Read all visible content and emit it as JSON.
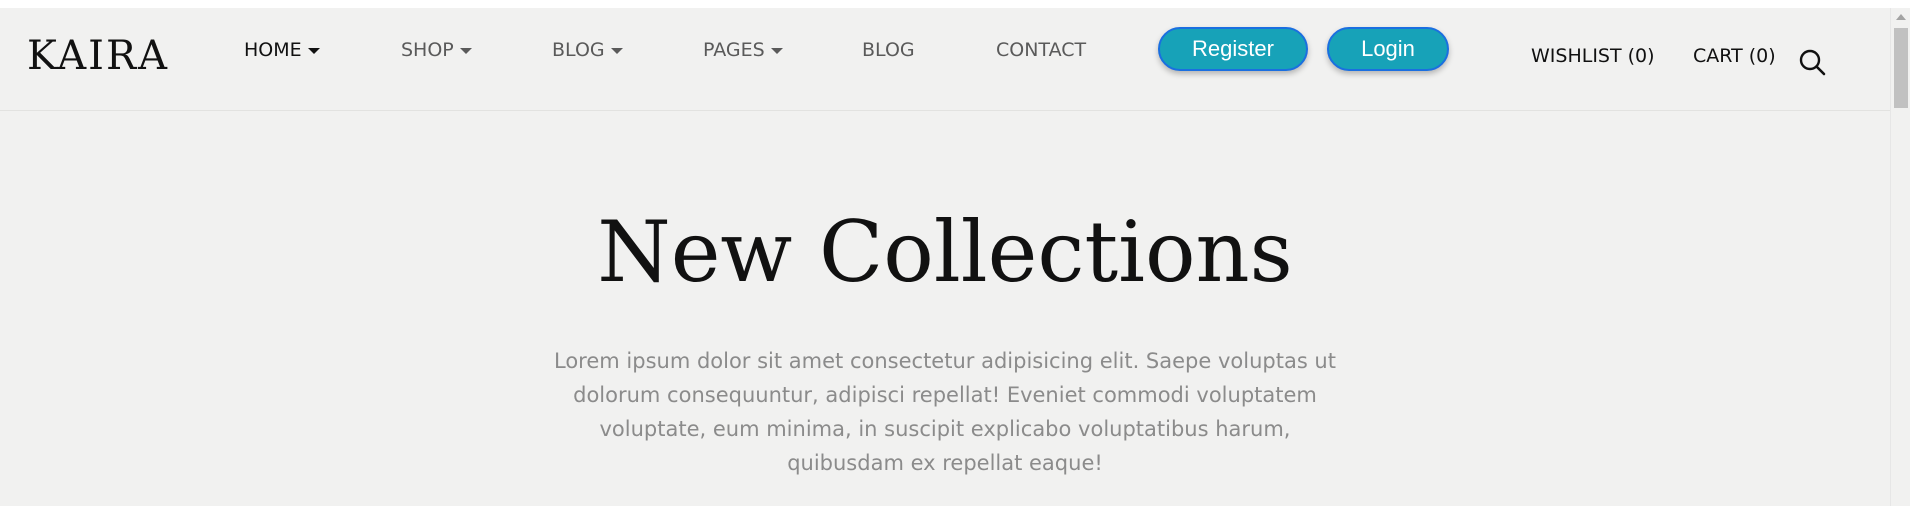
{
  "brand": {
    "logo": "KAIRA"
  },
  "nav": {
    "items": [
      {
        "label": "HOME",
        "dropdown": true,
        "active": true
      },
      {
        "label": "SHOP",
        "dropdown": true,
        "active": false
      },
      {
        "label": "BLOG",
        "dropdown": true,
        "active": false
      },
      {
        "label": "PAGES",
        "dropdown": true,
        "active": false
      },
      {
        "label": "BLOG",
        "dropdown": false,
        "active": false
      },
      {
        "label": "CONTACT",
        "dropdown": false,
        "active": false
      }
    ],
    "register_label": "Register",
    "login_label": "Login",
    "wishlist_label": "WISHLIST (0)",
    "cart_label": "CART (0)",
    "search_icon": "search-icon"
  },
  "hero": {
    "title": "New Collections",
    "text": "Lorem ipsum dolor sit amet consectetur adipisicing elit. Saepe voluptas ut dolorum consequuntur, adipisci repellat! Eveniet commodi voluptatem voluptate, eum minima, in suscipit explicabo voluptatibus harum, quibusdam ex repellat eaque!"
  },
  "colors": {
    "background": "#f1f1f0",
    "button_fill": "#17a2b8",
    "button_border": "#1a6fe0",
    "text_dark": "#111111",
    "text_muted": "#8b8b8b"
  }
}
